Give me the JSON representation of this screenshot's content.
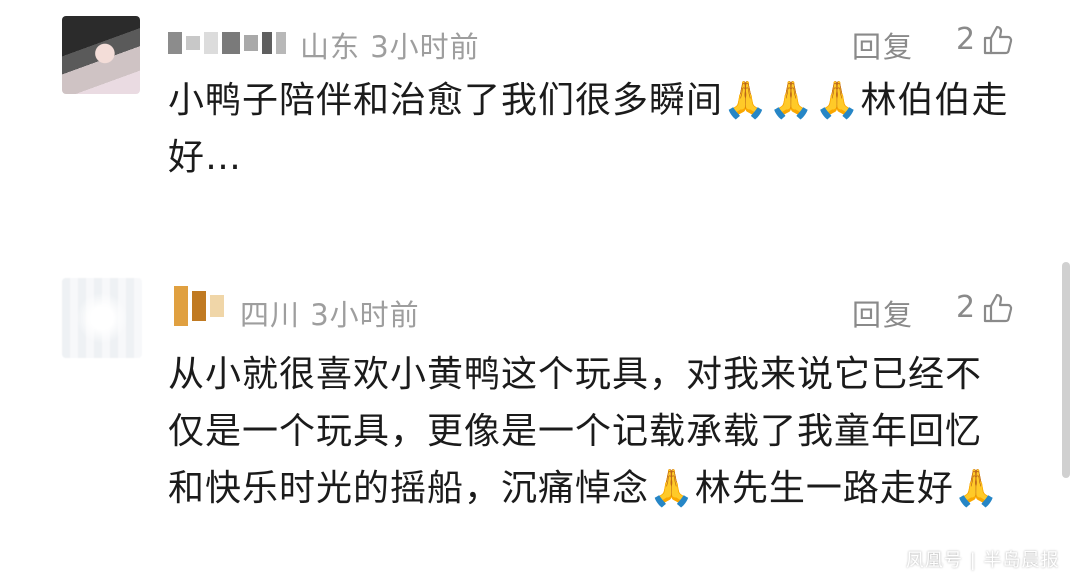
{
  "comments": [
    {
      "location": "山东",
      "time": "3小时前",
      "reply_label": "回复",
      "likes": "2",
      "text": "小鸭子陪伴和治愈了我们很多瞬间🙏🙏🙏林伯伯走好…"
    },
    {
      "location": "四川",
      "time": "3小时前",
      "reply_label": "回复",
      "likes": "2",
      "text": "从小就很喜欢小黄鸭这个玩具，对我来说它已经不仅是一个玩具，更像是一个记载承载了我童年回忆和快乐时光的摇船，沉痛悼念🙏林先生一路走好🙏"
    }
  ],
  "watermark": "凤凰号 | 半岛晨报",
  "icons": {
    "like": "thumbs-up-icon",
    "avatar": "user-avatar"
  },
  "colors": {
    "meta_text": "#9e9e9e",
    "body_text": "#1b1b1b",
    "scrollbar": "#d0d0d0"
  }
}
